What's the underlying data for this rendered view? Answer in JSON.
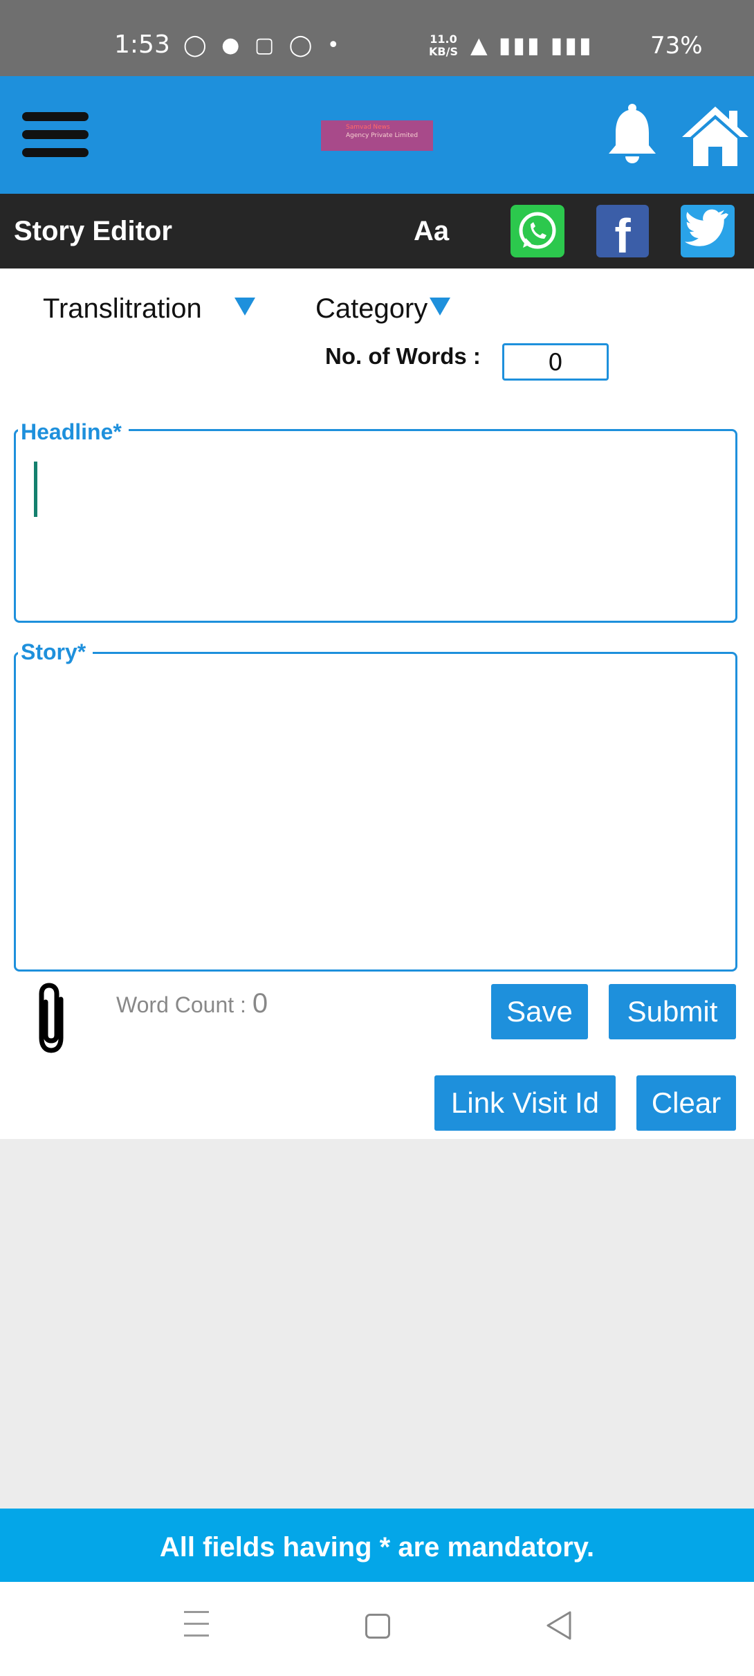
{
  "status_bar": {
    "time": "1:53",
    "net_speed_value": "11.0",
    "net_speed_unit": "KB/S",
    "battery": "73%"
  },
  "app_bar": {
    "logo_line1": "Samvad News",
    "logo_line2": "Agency Private Limited"
  },
  "toolbar": {
    "title": "Story Editor",
    "font_size_label": "Aa"
  },
  "form": {
    "transliteration_label": "Translitration",
    "category_label": "Category",
    "words_label": "No. of Words :",
    "words_value": "0",
    "headline_label": "Headline*",
    "headline_value": "",
    "story_label": "Story*",
    "story_value": "",
    "word_count_label": "Word Count :",
    "word_count_value": "0"
  },
  "buttons": {
    "save": "Save",
    "submit": "Submit",
    "link_visit": "Link Visit Id",
    "clear": "Clear"
  },
  "footer": {
    "mandatory_note": "All fields having * are mandatory."
  },
  "colors": {
    "accent": "#1e90dc",
    "toolbar_bg": "#262626",
    "banner_bg": "#04a6e8",
    "whatsapp": "#2cc84d",
    "facebook": "#3b5ea8",
    "twitter": "#2aa3e8"
  }
}
